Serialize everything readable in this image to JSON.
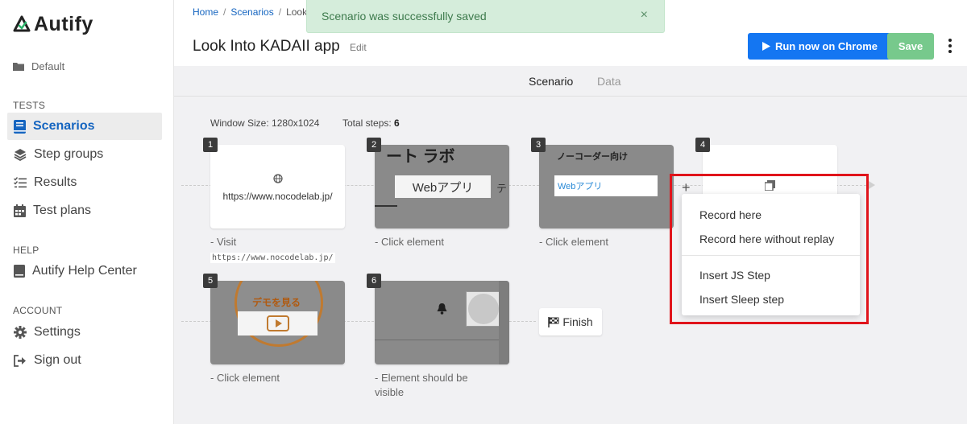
{
  "brand": {
    "name": "Autify",
    "accent": "#1565c0",
    "logo_check_color": "#2bb36b"
  },
  "sidebar": {
    "workspace": "Default",
    "sections": [
      {
        "title": "TESTS",
        "items": [
          {
            "label": "Scenarios",
            "icon": "scenarios-icon",
            "active": true
          },
          {
            "label": "Step groups",
            "icon": "layers-icon"
          },
          {
            "label": "Results",
            "icon": "checklist-icon"
          },
          {
            "label": "Test plans",
            "icon": "calendar-icon"
          }
        ]
      },
      {
        "title": "HELP",
        "items": [
          {
            "label": "Autify Help Center",
            "icon": "book-icon"
          }
        ]
      },
      {
        "title": "ACCOUNT",
        "items": [
          {
            "label": "Settings",
            "icon": "gear-icon"
          },
          {
            "label": "Sign out",
            "icon": "sign-out-icon"
          }
        ]
      }
    ]
  },
  "header": {
    "breadcrumbs": [
      "Home",
      "Scenarios",
      "Look"
    ],
    "title": "Look Into KADAII app",
    "edit_label": "Edit",
    "run_label": "Run now on Chrome",
    "save_label": "Save",
    "run_color": "#1476f2",
    "save_color": "#77c98c"
  },
  "toast": {
    "message": "Scenario was successfully saved",
    "close": "×"
  },
  "tabs": [
    "Scenario",
    "Data"
  ],
  "meta": {
    "window_size_label": "Window Size:",
    "window_size": "1280x1024",
    "total_steps_label": "Total steps:",
    "total_steps": "6"
  },
  "steps": [
    {
      "number": "1",
      "url": "https://www.nocodelab.jp/",
      "desc_prefix": "- Visit",
      "desc_code": "https://www.nocodelab.jp/"
    },
    {
      "number": "2",
      "thumb_text": "ート ラボ",
      "thumb_button": "Webアプリ",
      "thumb_side": "テ",
      "desc": "- Click element"
    },
    {
      "number": "3",
      "thumb_text": "ノーコーダー向け",
      "thumb_button": "Webアプリ",
      "desc": "- Click element"
    },
    {
      "number": "4",
      "icon": "copy-icon"
    },
    {
      "number": "5",
      "thumb_text": "デモを見る",
      "desc": "- Click element"
    },
    {
      "number": "6",
      "icon": "bell-icon",
      "desc": "- Element should be visible"
    }
  ],
  "finish_label": "Finish",
  "add_step": "+",
  "context_menu": {
    "items": [
      "Record here",
      "Record here without replay",
      "Insert JS Step",
      "Insert Sleep step"
    ],
    "highlight_color": "#e0141b"
  }
}
